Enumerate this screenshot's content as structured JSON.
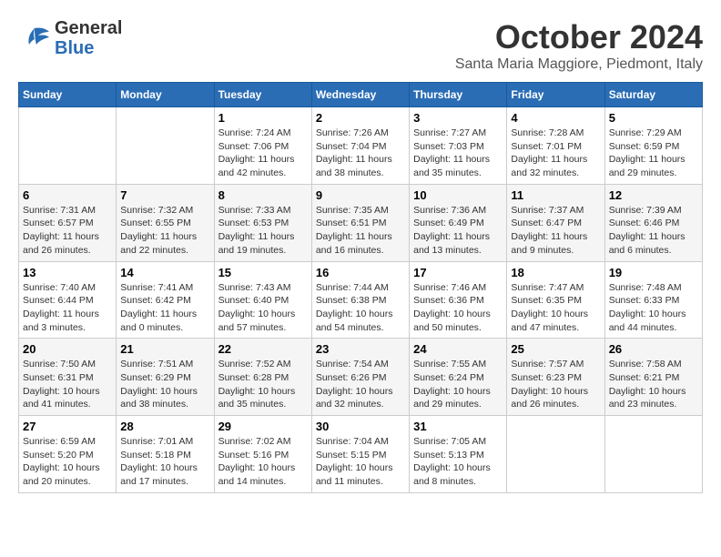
{
  "header": {
    "logo_general": "General",
    "logo_blue": "Blue",
    "month": "October 2024",
    "location": "Santa Maria Maggiore, Piedmont, Italy"
  },
  "weekdays": [
    "Sunday",
    "Monday",
    "Tuesday",
    "Wednesday",
    "Thursday",
    "Friday",
    "Saturday"
  ],
  "weeks": [
    [
      {
        "day": "",
        "info": ""
      },
      {
        "day": "",
        "info": ""
      },
      {
        "day": "1",
        "info": "Sunrise: 7:24 AM\nSunset: 7:06 PM\nDaylight: 11 hours and 42 minutes."
      },
      {
        "day": "2",
        "info": "Sunrise: 7:26 AM\nSunset: 7:04 PM\nDaylight: 11 hours and 38 minutes."
      },
      {
        "day": "3",
        "info": "Sunrise: 7:27 AM\nSunset: 7:03 PM\nDaylight: 11 hours and 35 minutes."
      },
      {
        "day": "4",
        "info": "Sunrise: 7:28 AM\nSunset: 7:01 PM\nDaylight: 11 hours and 32 minutes."
      },
      {
        "day": "5",
        "info": "Sunrise: 7:29 AM\nSunset: 6:59 PM\nDaylight: 11 hours and 29 minutes."
      }
    ],
    [
      {
        "day": "6",
        "info": "Sunrise: 7:31 AM\nSunset: 6:57 PM\nDaylight: 11 hours and 26 minutes."
      },
      {
        "day": "7",
        "info": "Sunrise: 7:32 AM\nSunset: 6:55 PM\nDaylight: 11 hours and 22 minutes."
      },
      {
        "day": "8",
        "info": "Sunrise: 7:33 AM\nSunset: 6:53 PM\nDaylight: 11 hours and 19 minutes."
      },
      {
        "day": "9",
        "info": "Sunrise: 7:35 AM\nSunset: 6:51 PM\nDaylight: 11 hours and 16 minutes."
      },
      {
        "day": "10",
        "info": "Sunrise: 7:36 AM\nSunset: 6:49 PM\nDaylight: 11 hours and 13 minutes."
      },
      {
        "day": "11",
        "info": "Sunrise: 7:37 AM\nSunset: 6:47 PM\nDaylight: 11 hours and 9 minutes."
      },
      {
        "day": "12",
        "info": "Sunrise: 7:39 AM\nSunset: 6:46 PM\nDaylight: 11 hours and 6 minutes."
      }
    ],
    [
      {
        "day": "13",
        "info": "Sunrise: 7:40 AM\nSunset: 6:44 PM\nDaylight: 11 hours and 3 minutes."
      },
      {
        "day": "14",
        "info": "Sunrise: 7:41 AM\nSunset: 6:42 PM\nDaylight: 11 hours and 0 minutes."
      },
      {
        "day": "15",
        "info": "Sunrise: 7:43 AM\nSunset: 6:40 PM\nDaylight: 10 hours and 57 minutes."
      },
      {
        "day": "16",
        "info": "Sunrise: 7:44 AM\nSunset: 6:38 PM\nDaylight: 10 hours and 54 minutes."
      },
      {
        "day": "17",
        "info": "Sunrise: 7:46 AM\nSunset: 6:36 PM\nDaylight: 10 hours and 50 minutes."
      },
      {
        "day": "18",
        "info": "Sunrise: 7:47 AM\nSunset: 6:35 PM\nDaylight: 10 hours and 47 minutes."
      },
      {
        "day": "19",
        "info": "Sunrise: 7:48 AM\nSunset: 6:33 PM\nDaylight: 10 hours and 44 minutes."
      }
    ],
    [
      {
        "day": "20",
        "info": "Sunrise: 7:50 AM\nSunset: 6:31 PM\nDaylight: 10 hours and 41 minutes."
      },
      {
        "day": "21",
        "info": "Sunrise: 7:51 AM\nSunset: 6:29 PM\nDaylight: 10 hours and 38 minutes."
      },
      {
        "day": "22",
        "info": "Sunrise: 7:52 AM\nSunset: 6:28 PM\nDaylight: 10 hours and 35 minutes."
      },
      {
        "day": "23",
        "info": "Sunrise: 7:54 AM\nSunset: 6:26 PM\nDaylight: 10 hours and 32 minutes."
      },
      {
        "day": "24",
        "info": "Sunrise: 7:55 AM\nSunset: 6:24 PM\nDaylight: 10 hours and 29 minutes."
      },
      {
        "day": "25",
        "info": "Sunrise: 7:57 AM\nSunset: 6:23 PM\nDaylight: 10 hours and 26 minutes."
      },
      {
        "day": "26",
        "info": "Sunrise: 7:58 AM\nSunset: 6:21 PM\nDaylight: 10 hours and 23 minutes."
      }
    ],
    [
      {
        "day": "27",
        "info": "Sunrise: 6:59 AM\nSunset: 5:20 PM\nDaylight: 10 hours and 20 minutes."
      },
      {
        "day": "28",
        "info": "Sunrise: 7:01 AM\nSunset: 5:18 PM\nDaylight: 10 hours and 17 minutes."
      },
      {
        "day": "29",
        "info": "Sunrise: 7:02 AM\nSunset: 5:16 PM\nDaylight: 10 hours and 14 minutes."
      },
      {
        "day": "30",
        "info": "Sunrise: 7:04 AM\nSunset: 5:15 PM\nDaylight: 10 hours and 11 minutes."
      },
      {
        "day": "31",
        "info": "Sunrise: 7:05 AM\nSunset: 5:13 PM\nDaylight: 10 hours and 8 minutes."
      },
      {
        "day": "",
        "info": ""
      },
      {
        "day": "",
        "info": ""
      }
    ]
  ]
}
